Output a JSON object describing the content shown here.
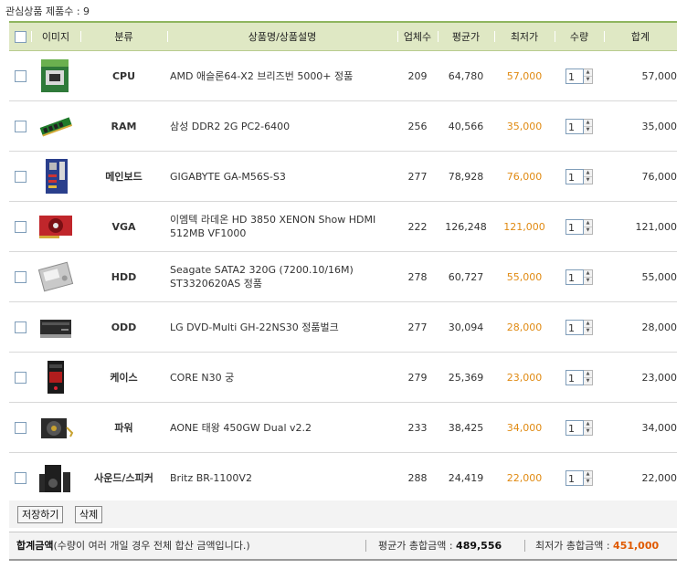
{
  "header": {
    "label": "관심상품 제품수 : 9"
  },
  "columns": {
    "image": "이미지",
    "category": "분류",
    "name": "상품명/상품설명",
    "makers": "업체수",
    "avg": "평균가",
    "lowest": "최저가",
    "qty": "수량",
    "sum": "합계"
  },
  "rows": [
    {
      "category": "CPU",
      "name1": "AMD 애슬론64-X2 브리즈번 5000+ 정품",
      "name2": "",
      "makers": "209",
      "avg": "64,780",
      "low": "57,000",
      "qty": "1",
      "sum": "57,000",
      "icon": "cpu-box-icon"
    },
    {
      "category": "RAM",
      "name1": "삼성 DDR2 2G PC2-6400",
      "name2": "",
      "makers": "256",
      "avg": "40,566",
      "low": "35,000",
      "qty": "1",
      "sum": "35,000",
      "icon": "ram-stick-icon"
    },
    {
      "category": "메인보드",
      "name1": "GIGABYTE GA-M56S-S3",
      "name2": "",
      "makers": "277",
      "avg": "78,928",
      "low": "76,000",
      "qty": "1",
      "sum": "76,000",
      "icon": "motherboard-icon"
    },
    {
      "category": "VGA",
      "name1": "이엠텍 라데온 HD 3850 XENON Show HDMI",
      "name2": "512MB VF1000",
      "makers": "222",
      "avg": "126,248",
      "low": "121,000",
      "qty": "1",
      "sum": "121,000",
      "icon": "graphics-card-icon"
    },
    {
      "category": "HDD",
      "name1": "Seagate SATA2 320G (7200.10/16M)",
      "name2": "ST3320620AS 정품",
      "makers": "278",
      "avg": "60,727",
      "low": "55,000",
      "qty": "1",
      "sum": "55,000",
      "icon": "hard-drive-icon"
    },
    {
      "category": "ODD",
      "name1": "LG DVD-Multi GH-22NS30 정품벌크",
      "name2": "",
      "makers": "277",
      "avg": "30,094",
      "low": "28,000",
      "qty": "1",
      "sum": "28,000",
      "icon": "dvd-drive-icon"
    },
    {
      "category": "케이스",
      "name1": "CORE N30 궁",
      "name2": "",
      "makers": "279",
      "avg": "25,369",
      "low": "23,000",
      "qty": "1",
      "sum": "23,000",
      "icon": "pc-case-icon"
    },
    {
      "category": "파워",
      "name1": "AONE 태왕 450GW Dual v2.2",
      "name2": "",
      "makers": "233",
      "avg": "38,425",
      "low": "34,000",
      "qty": "1",
      "sum": "34,000",
      "icon": "power-supply-icon"
    },
    {
      "category": "사운드/스피커",
      "name1": "Britz BR-1100V2",
      "name2": "",
      "makers": "288",
      "avg": "24,419",
      "low": "22,000",
      "qty": "1",
      "sum": "22,000",
      "icon": "speaker-icon"
    }
  ],
  "buttons": {
    "save": "저장하기",
    "delete": "삭제"
  },
  "totals": {
    "label": "합계금액",
    "note": "(수량이 여러 개일 경우 전체 합산 금액입니다.)",
    "avg_label": "평균가 총합금액 :",
    "avg_value": "489,556",
    "low_label": "최저가 총합금액 :",
    "low_value": "451,000"
  },
  "colors": {
    "header_bg": "#dfe8c4",
    "header_border": "#8fb55f",
    "lowest_price": "#e08a12",
    "total_lowest": "#e05a00"
  }
}
